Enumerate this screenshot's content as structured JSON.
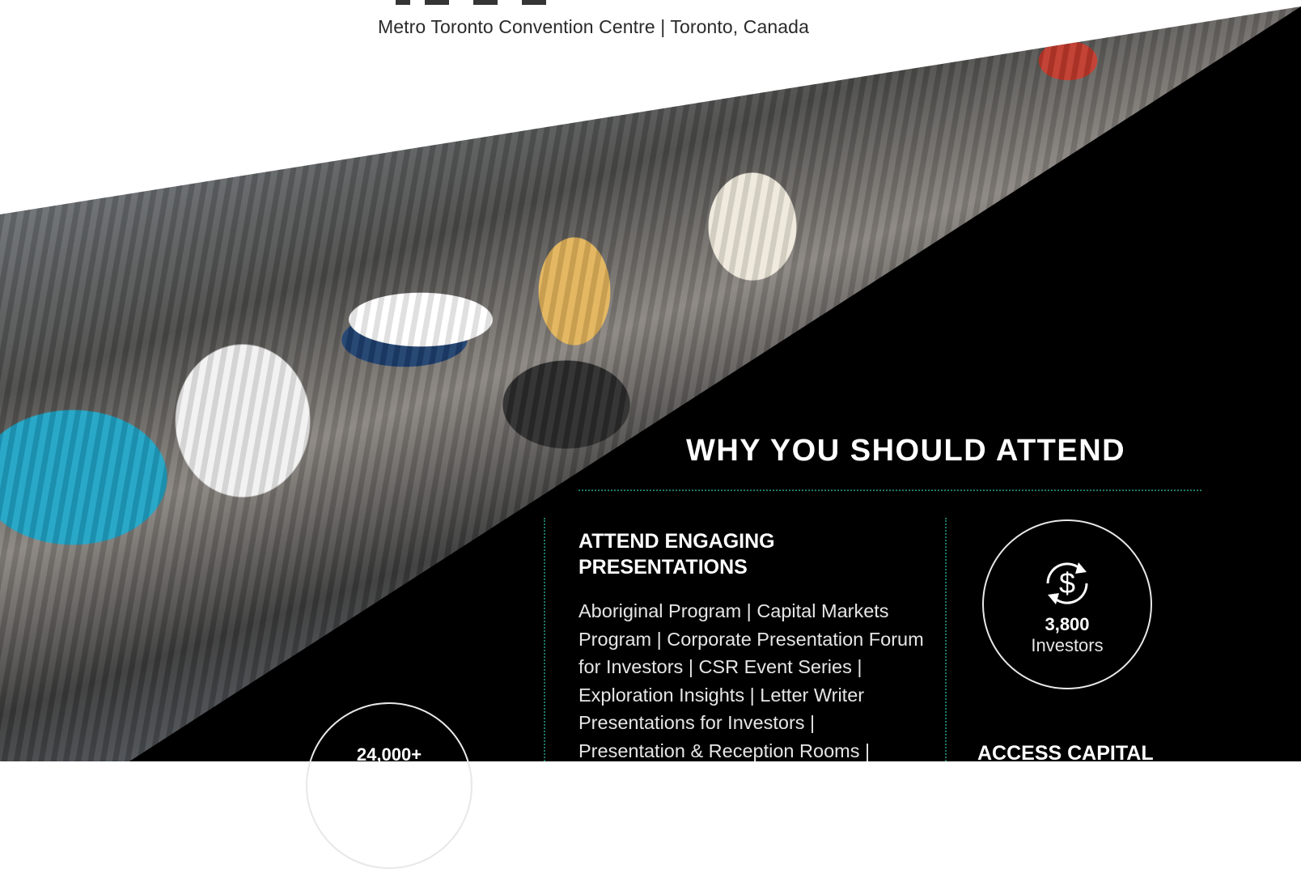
{
  "header": {
    "venue": "Metro Toronto Convention Centre | Toronto, Canada"
  },
  "why_attend": {
    "heading": "WHY YOU SHOULD ATTEND",
    "presentations_heading": "ATTEND ENGAGING PRESENTATIONS",
    "presentations_text": "Aboriginal Program | Capital Markets Program | Corporate Presentation Forum for Investors  |  CSR Event Series | Exploration Insights | Letter Writer Presentations for Investors | Presentation & Reception Rooms |",
    "access_capital_heading": "ACCESS CAPITAL"
  },
  "stats": {
    "investors": {
      "number": "3,800",
      "label": "Investors",
      "icon": "dollar-cycle-icon"
    },
    "attendees": {
      "number": "24,000+"
    }
  },
  "colors": {
    "panel": "#000000",
    "divider": "#1e7a6a",
    "text": "#ffffff"
  }
}
